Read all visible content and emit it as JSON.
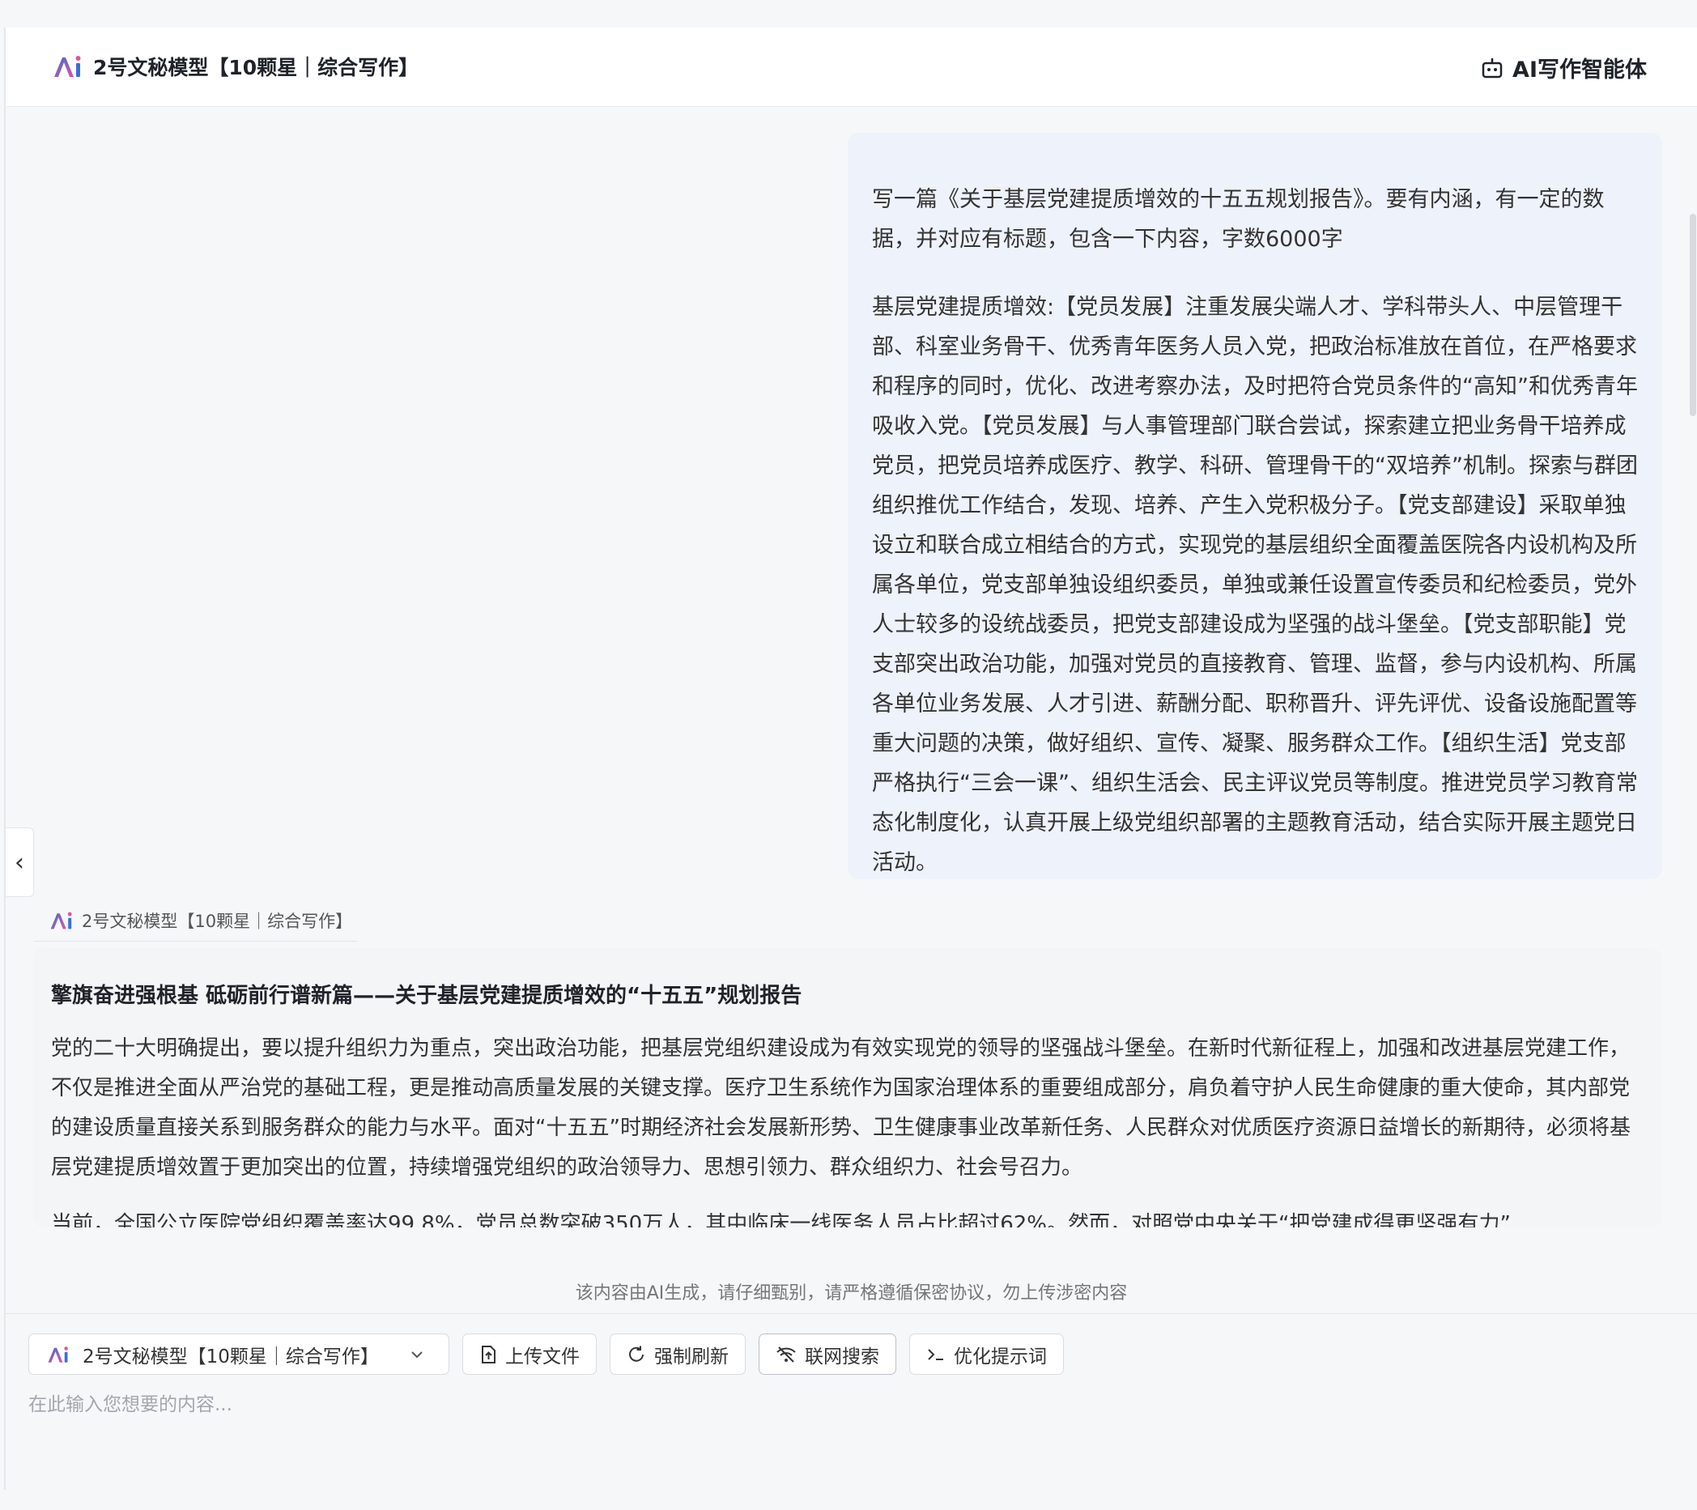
{
  "header": {
    "model_title": "2号文秘模型【10颗星｜综合写作】",
    "agent_label": "AI写作智能体"
  },
  "conversation": {
    "user_message": {
      "paragraph_1": "写一篇《关于基层党建提质增效的十五五规划报告》。要有内涵，有一定的数据，并对应有标题，包含一下内容，字数6000字",
      "paragraph_2": "基层党建提质增效:【党员发展】注重发展尖端人才、学科带头人、中层管理干部、科室业务骨干、优秀青年医务人员入党，把政治标准放在首位，在严格要求和程序的同时，优化、改进考察办法，及时把符合党员条件的“高知”和优秀青年吸收入党。【党员发展】与人事管理部门联合尝试，探索建立把业务骨干培养成党员，把党员培养成医疗、教学、科研、管理骨干的“双培养”机制。探索与群团组织推优工作结合，发现、培养、产生入党积极分子。【党支部建设】采取单独设立和联合成立相结合的方式，实现党的基层组织全面覆盖医院各内设机构及所属各单位，党支部单独设组织委员，单独或兼任设置宣传委员和纪检委员，党外人士较多的设统战委员，把党支部建设成为坚强的战斗堡垒。【党支部职能】党支部突出政治功能，加强对党员的直接教育、管理、监督，参与内设机构、所属各单位业务发展、人才引进、薪酬分配、职称晋升、评先评优、设备设施配置等重大问题的决策，做好组织、宣传、凝聚、服务群众工作。【组织生活】党支部严格执行“三会一课”、组织生活会、民主评议党员等制度。推进党员学习教育常态化制度化，认真开展上级党组织部署的主题教育活动，结合实际开展主题党日活动。"
    },
    "assistant": {
      "model_tag": "2号文秘模型【10颗星｜综合写作】",
      "title": "擎旗奋进强根基 砥砺前行谱新篇——关于基层党建提质增效的“十五五”规划报告",
      "paragraph_1": "党的二十大明确提出，要以提升组织力为重点，突出政治功能，把基层党组织建设成为有效实现党的领导的坚强战斗堡垒。在新时代新征程上，加强和改进基层党建工作，不仅是推进全面从严治党的基础工程，更是推动高质量发展的关键支撑。医疗卫生系统作为国家治理体系的重要组成部分，肩负着守护人民生命健康的重大使命，其内部党的建设质量直接关系到服务群众的能力与水平。面对“十五五”时期经济社会发展新形势、卫生健康事业改革新任务、人民群众对优质医疗资源日益增长的新期待，必须将基层党建提质增效置于更加突出的位置，持续增强党组织的政治领导力、思想引领力、群众组织力、社会号召力。",
      "paragraph_2": "当前，全国公立医院党组织覆盖率达99.8%，党员总数突破350万人，其中临床一线医务人员占比超过62%。然而，对照党中央关于“把党建成得更坚强有力”"
    }
  },
  "disclaimer": "该内容由AI生成，请仔细甄别，请严格遵循保密协议，勿上传涉密内容",
  "composer": {
    "model_select": "2号文秘模型【10颗星｜综合写作】",
    "upload_label": "上传文件",
    "refresh_label": "强制刷新",
    "web_search_label": "联网搜索",
    "optimize_label": "优化提示词",
    "placeholder": "在此输入您想要的内容..."
  },
  "colors": {
    "user_bubble": "#eef2fb",
    "answer_card": "#f4f5f7",
    "logo_blue": "#3b6fd8",
    "logo_pink": "#e0539b"
  }
}
